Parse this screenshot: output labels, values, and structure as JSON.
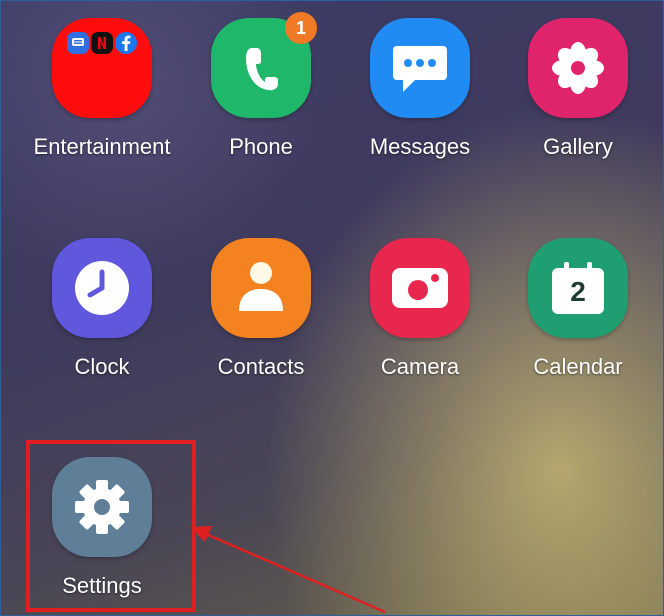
{
  "apps": [
    {
      "label": "Entertainment",
      "icon": "entertainment-folder-icon",
      "color": "#ff0d0d"
    },
    {
      "label": "Phone",
      "icon": "phone-icon",
      "color": "#1fb86a",
      "badge": "1",
      "badge_color": "#f07a26"
    },
    {
      "label": "Messages",
      "icon": "messages-icon",
      "color": "#1f8bf3"
    },
    {
      "label": "Gallery",
      "icon": "gallery-flower-icon",
      "color": "#e0246c"
    },
    {
      "label": "Clock",
      "icon": "clock-icon",
      "color": "#5f58dd"
    },
    {
      "label": "Contacts",
      "icon": "contacts-icon",
      "color": "#f58220"
    },
    {
      "label": "Camera",
      "icon": "camera-icon",
      "color": "#e8274f"
    },
    {
      "label": "Calendar",
      "icon": "calendar-icon",
      "color": "#1f9e72",
      "calendar_day": "2"
    },
    {
      "label": "Settings",
      "icon": "gear-icon",
      "color": "#5f7f99"
    }
  ],
  "folder_mini_icons": [
    "tv-icon",
    "netflix-icon",
    "facebook-icon"
  ],
  "annotation": {
    "highlight_color": "#e02020",
    "arrow_color": "#e02020"
  }
}
